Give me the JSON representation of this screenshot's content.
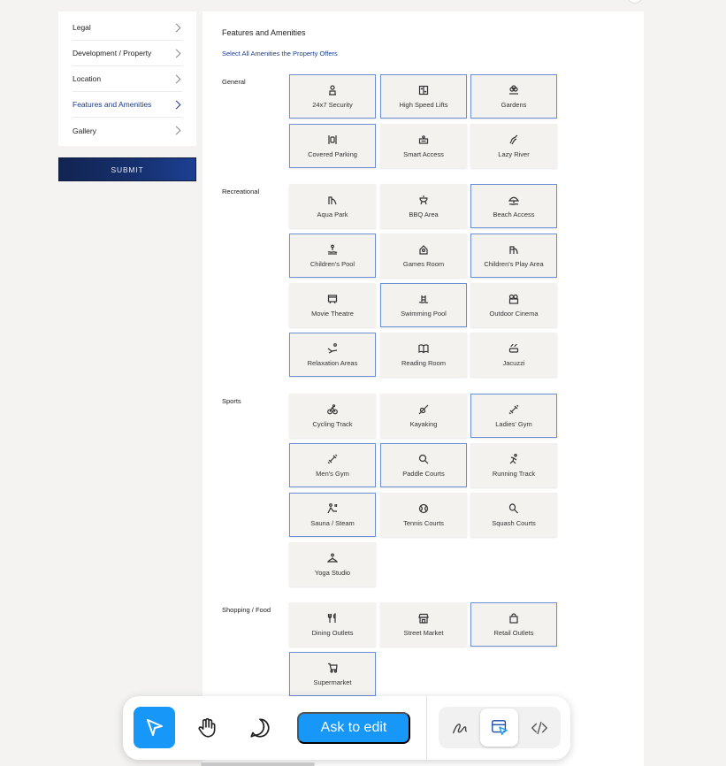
{
  "sidebar": {
    "items": [
      {
        "label": "Legal",
        "active": false
      },
      {
        "label": "Development / Property",
        "active": false
      },
      {
        "label": "Location",
        "active": false
      },
      {
        "label": "Features and Amenities",
        "active": true
      },
      {
        "label": "Gallery",
        "active": false
      }
    ],
    "submit_label": "SUBMIT"
  },
  "main": {
    "title": "Features and Amenities",
    "subtitle": "Select All Amenities the Property Offers",
    "groups": [
      {
        "label": "General",
        "items": [
          {
            "label": "24x7 Security",
            "icon": "guard-icon",
            "selected": true
          },
          {
            "label": "High Speed Lifts",
            "icon": "elevator-icon",
            "selected": true
          },
          {
            "label": "Gardens",
            "icon": "garden-icon",
            "selected": true
          },
          {
            "label": "Covered Parking",
            "icon": "parking-icon",
            "selected": true
          },
          {
            "label": "Smart Access",
            "icon": "smart-access-icon",
            "selected": false
          },
          {
            "label": "Lazy River",
            "icon": "river-icon",
            "selected": false
          }
        ]
      },
      {
        "label": "Recreational",
        "items": [
          {
            "label": "Aqua Park",
            "icon": "aqua-park-icon",
            "selected": false
          },
          {
            "label": "BBQ Area",
            "icon": "bbq-icon",
            "selected": false
          },
          {
            "label": "Beach Access",
            "icon": "beach-icon",
            "selected": true
          },
          {
            "label": "Children's Pool",
            "icon": "kids-pool-icon",
            "selected": true
          },
          {
            "label": "Games Room",
            "icon": "games-icon",
            "selected": false
          },
          {
            "label": "Children's Play Area",
            "icon": "play-area-icon",
            "selected": true
          },
          {
            "label": "Movie Theatre",
            "icon": "movie-icon",
            "selected": false
          },
          {
            "label": "Swimming Pool",
            "icon": "pool-icon",
            "selected": true
          },
          {
            "label": "Outdoor Cinema",
            "icon": "cinema-icon",
            "selected": false
          },
          {
            "label": "Relaxation Areas",
            "icon": "relax-icon",
            "selected": true
          },
          {
            "label": "Reading Room",
            "icon": "book-icon",
            "selected": false
          },
          {
            "label": "Jacuzzi",
            "icon": "jacuzzi-icon",
            "selected": false
          }
        ]
      },
      {
        "label": "Sports",
        "items": [
          {
            "label": "Cycling Track",
            "icon": "cycling-icon",
            "selected": false
          },
          {
            "label": "Kayaking",
            "icon": "kayak-icon",
            "selected": false
          },
          {
            "label": "Ladies' Gym",
            "icon": "dumbbell-icon",
            "selected": true
          },
          {
            "label": "Men's Gym",
            "icon": "dumbbell-icon",
            "selected": true
          },
          {
            "label": "Paddle Courts",
            "icon": "paddle-icon",
            "selected": true
          },
          {
            "label": "Running Track",
            "icon": "running-icon",
            "selected": false
          },
          {
            "label": "Sauna / Steam",
            "icon": "sauna-icon",
            "selected": true
          },
          {
            "label": "Tennis Courts",
            "icon": "tennis-icon",
            "selected": false
          },
          {
            "label": "Squash Courts",
            "icon": "squash-icon",
            "selected": false
          },
          {
            "label": "Yoga Studio",
            "icon": "yoga-icon",
            "selected": false
          }
        ]
      },
      {
        "label": "Shopping / Food",
        "items": [
          {
            "label": "Dining Outlets",
            "icon": "dining-icon",
            "selected": false
          },
          {
            "label": "Street Market",
            "icon": "market-icon",
            "selected": false
          },
          {
            "label": "Retail Outlets",
            "icon": "bag-icon",
            "selected": true
          },
          {
            "label": "Supermarket",
            "icon": "cart-icon",
            "selected": true
          }
        ]
      }
    ]
  },
  "toolbar": {
    "ask_label": "Ask to edit",
    "tools": [
      "select-tool-icon",
      "hand-tool-icon",
      "comment-tool-icon"
    ],
    "modes": [
      "draw-mode-icon",
      "design-mode-icon",
      "code-mode-icon"
    ],
    "accent": "#1797f7"
  }
}
